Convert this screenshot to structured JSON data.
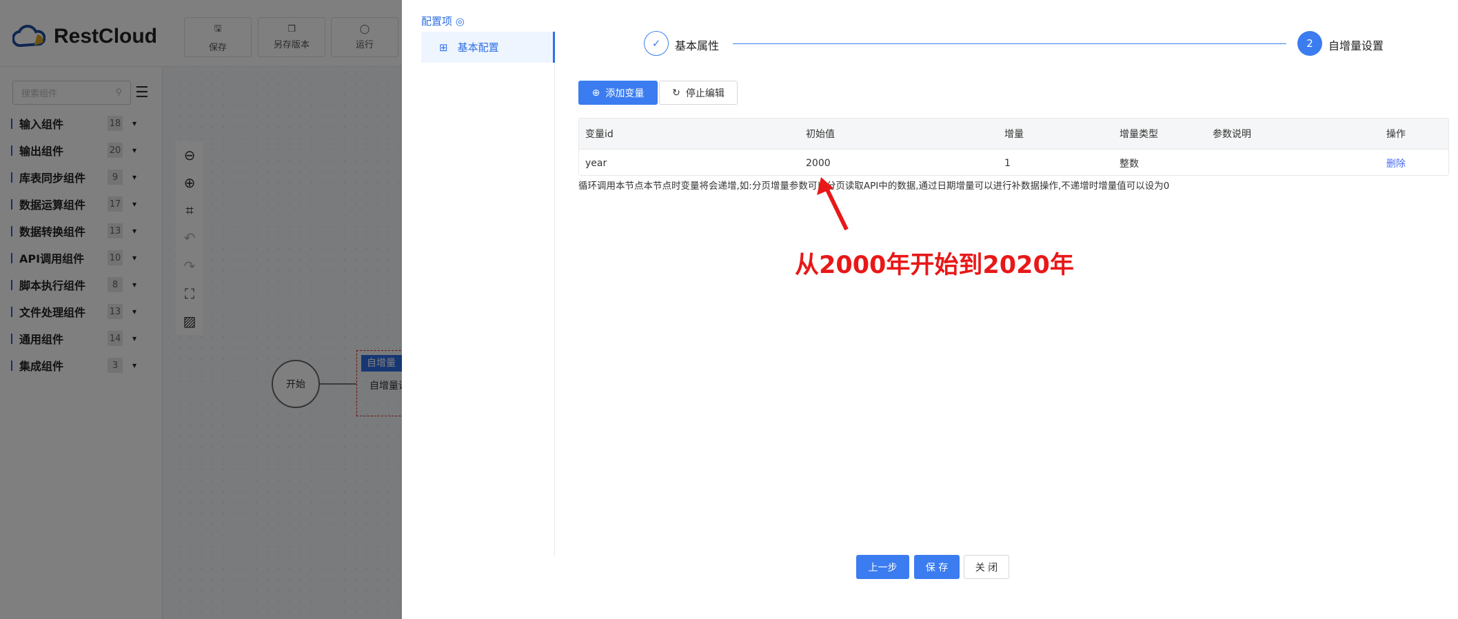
{
  "app": {
    "brand": "RestCloud",
    "toolbar": [
      {
        "label": "保存",
        "icon": "save-icon"
      },
      {
        "label": "另存版本",
        "icon": "save-version-icon"
      },
      {
        "label": "运行",
        "icon": "run-icon"
      }
    ]
  },
  "sidebar": {
    "search_placeholder": "搜索组件",
    "categories": [
      {
        "name": "输入组件",
        "count": "18"
      },
      {
        "name": "输出组件",
        "count": "20"
      },
      {
        "name": "库表同步组件",
        "count": "9"
      },
      {
        "name": "数据运算组件",
        "count": "17"
      },
      {
        "name": "数据转换组件",
        "count": "13"
      },
      {
        "name": "API调用组件",
        "count": "10"
      },
      {
        "name": "脚本执行组件",
        "count": "8"
      },
      {
        "name": "文件处理组件",
        "count": "13"
      },
      {
        "name": "通用组件",
        "count": "14"
      },
      {
        "name": "集成组件",
        "count": "3"
      }
    ]
  },
  "canvas": {
    "start_label": "开始",
    "node_header": "自增量",
    "node_body": "自增量设"
  },
  "drawer": {
    "config_title": "配置项",
    "menu_item": "基本配置",
    "steps": [
      {
        "label": "基本属性",
        "state": "done"
      },
      {
        "number": "2",
        "label": "自增量设置",
        "state": "active"
      }
    ],
    "add_button": "添加变量",
    "stop_button": "停止编辑",
    "table": {
      "headers": [
        "变量id",
        "初始值",
        "增量",
        "增量类型",
        "参数说明",
        "操作"
      ],
      "rows": [
        {
          "id": "year",
          "initial": "2000",
          "increment": "1",
          "type": "整数",
          "desc": "",
          "action": "删除"
        }
      ]
    },
    "note": "循环调用本节点本节点时变量将会递增,如:分页增量参数可以分页读取API中的数据,通过日期增量可以进行补数据操作,不递增时增量值可以设为0",
    "footer": {
      "prev": "上一步",
      "save": "保 存",
      "close": "关 闭"
    }
  },
  "annotation": {
    "text": "从2000年开始到2020年",
    "color": "#e81818"
  },
  "colors": {
    "primary": "#3b7cf0"
  }
}
